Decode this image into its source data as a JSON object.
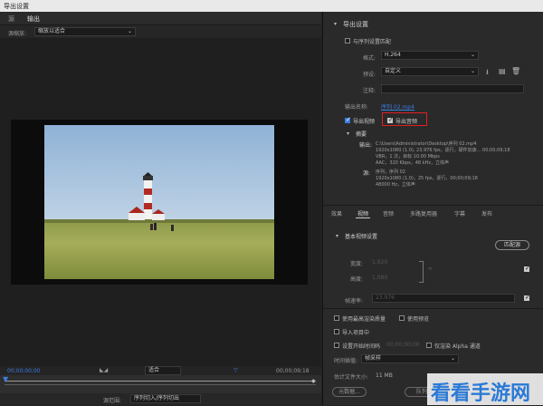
{
  "window": {
    "title": "导出设置"
  },
  "left_tabs": [
    "源",
    "输出"
  ],
  "source": {
    "label": "源缩放:",
    "value": "缩放以适合"
  },
  "timeline": {
    "start_tc": "00;00;00;00",
    "end_tc": "00;00;09;18",
    "fit_label": "适合"
  },
  "range": {
    "label": "源范围:",
    "value": "序列切入/序列切出"
  },
  "export": {
    "section_title": "导出设置",
    "match_sequence": "与序列设置匹配",
    "format_label": "格式:",
    "format_value": "H.264",
    "preset_label": "预设:",
    "preset_value": "自定义",
    "comment_label": "注释:",
    "output_name_label": "输出名称:",
    "output_name_value": "序列 02.mp4",
    "export_video": "导出视频",
    "export_audio": "导出音频",
    "summary_title": "摘要",
    "summary_output_label": "输出:",
    "summary_output_lines": [
      "C:\\Users\\Administrator\\Desktop\\序列 02.mp4",
      "1920x1080 (1.0), 23.976 fps，逐行，硬件加速... 00;00;09;18",
      "VBR，1 次，目标 10.00 Mbps",
      "AAC，320 Kbps，48 kHz，立体声"
    ],
    "summary_source_label": "源:",
    "summary_source_lines": [
      "序列，序列 02",
      "1920x1080 (1.0)，25 fps，逐行，00;00;09;18",
      "48000 Hz，立体声"
    ]
  },
  "tabs_right": [
    "效果",
    "视频",
    "音频",
    "多路复用器",
    "字幕",
    "发布"
  ],
  "video": {
    "section_title": "基本视频设置",
    "match_source_btn": "匹配源",
    "width_label": "宽度:",
    "width_value": "1,920",
    "height_label": "高度:",
    "height_value": "1,080",
    "framerate_label": "帧速率:",
    "framerate_value": "23.976"
  },
  "options": {
    "max_render": "使用最高渲染质量",
    "use_previews": "使用预览",
    "import_project": "导入项目中",
    "set_start_tc": "设置开始时间码",
    "start_tc_value": "00;00;00;00",
    "render_alpha": "仅渲染 Alpha 通道",
    "interp_label": "时间插值:",
    "interp_value": "帧采样",
    "filesize_label": "估计文件大小:",
    "filesize_value": "11 MB"
  },
  "buttons": {
    "metadata": "元数据...",
    "queue": "队列"
  },
  "watermark": "看看手游网"
}
